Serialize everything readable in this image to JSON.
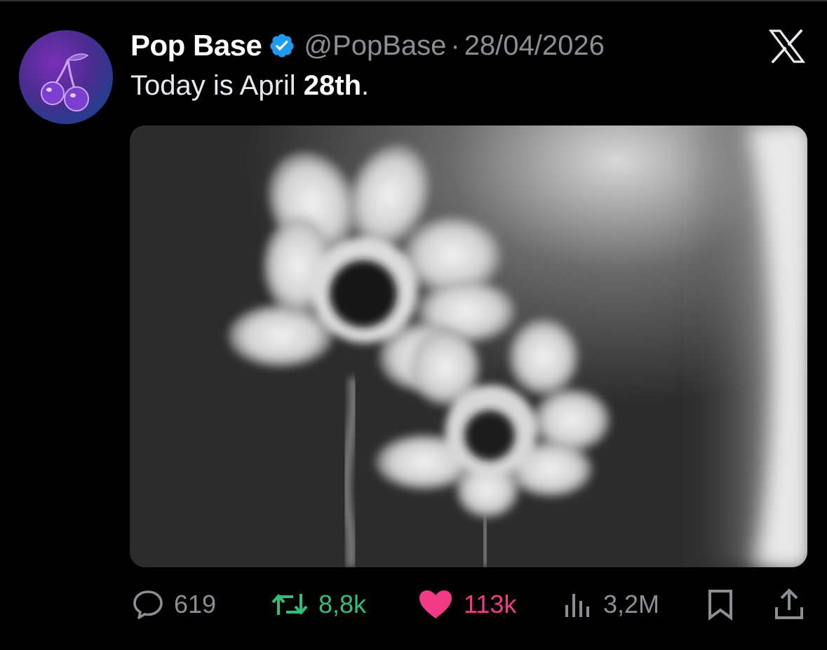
{
  "tweet": {
    "author_name": "Pop Base",
    "handle": "@PopBase",
    "separator": "·",
    "date": "28/04/2026",
    "text_prefix": "Today is April ",
    "text_bold": "28th",
    "text_suffix": "."
  },
  "icons": {
    "avatar": "cherries-icon",
    "verified": "verified-badge-icon",
    "platform": "x-logo-icon",
    "reply": "comment-icon",
    "retweet": "retweet-icon",
    "like": "heart-icon",
    "views": "views-icon",
    "bookmark": "bookmark-icon",
    "share": "share-icon"
  },
  "actions": {
    "replies": "619",
    "retweets": "8,8k",
    "likes": "113k",
    "views": "3,2M"
  },
  "colors": {
    "background": "#000000",
    "verified": "#1d9bf0",
    "retweet": "#2fbf7a",
    "like": "#f23a87",
    "muted": "#8b8f94"
  }
}
